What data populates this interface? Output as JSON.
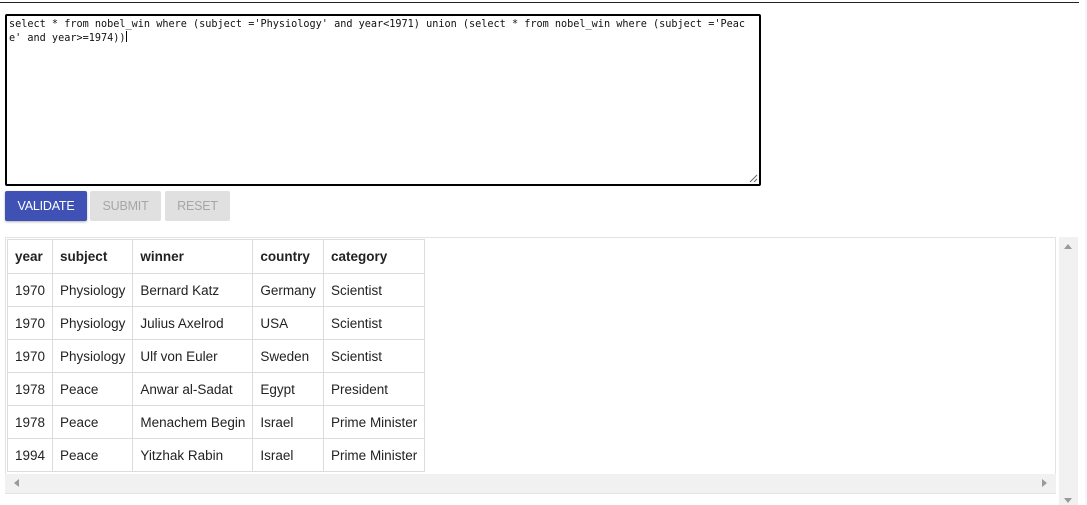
{
  "editor": {
    "query": "select * from nobel_win where (subject ='Physiology' and year<1971) union (select * from nobel_win where (subject ='Peace' and year>=1974))"
  },
  "buttons": {
    "validate": "VALIDATE",
    "submit": "SUBMIT",
    "reset": "RESET"
  },
  "colors": {
    "validate_bg": "#3f51b5",
    "disabled_bg": "#e0e0e0",
    "disabled_text": "#a6a6a6"
  },
  "results": {
    "columns": [
      "year",
      "subject",
      "winner",
      "country",
      "category"
    ],
    "rows": [
      [
        "1970",
        "Physiology",
        "Bernard Katz",
        "Germany",
        "Scientist"
      ],
      [
        "1970",
        "Physiology",
        "Julius Axelrod",
        "USA",
        "Scientist"
      ],
      [
        "1970",
        "Physiology",
        "Ulf von Euler",
        "Sweden",
        "Scientist"
      ],
      [
        "1978",
        "Peace",
        "Anwar al-Sadat",
        "Egypt",
        "President"
      ],
      [
        "1978",
        "Peace",
        "Menachem Begin",
        "Israel",
        "Prime Minister"
      ],
      [
        "1994",
        "Peace",
        "Yitzhak Rabin",
        "Israel",
        "Prime Minister"
      ]
    ]
  }
}
